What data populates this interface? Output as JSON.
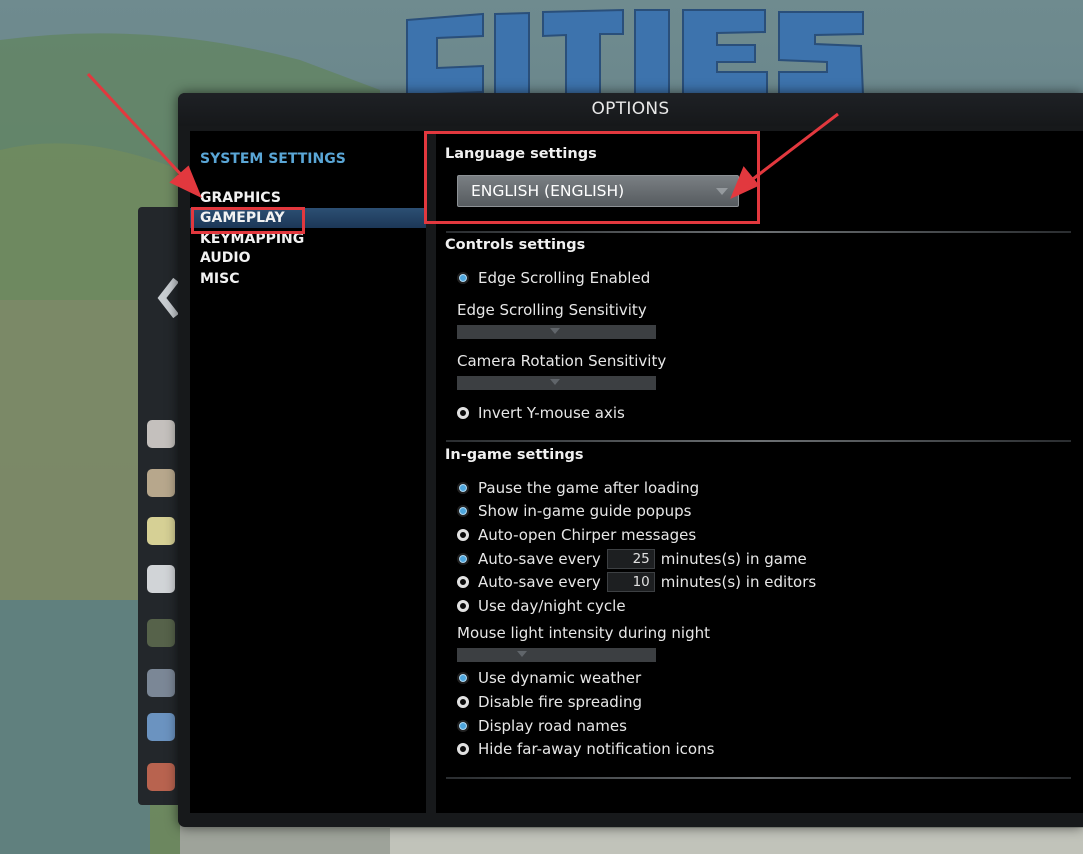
{
  "window": {
    "title": "OPTIONS"
  },
  "logo_text": "CITIES",
  "sidebar": {
    "title": "SYSTEM SETTINGS",
    "items": [
      {
        "label": "GRAPHICS",
        "selected": false
      },
      {
        "label": "GAMEPLAY",
        "selected": true
      },
      {
        "label": "KEYMAPPING",
        "selected": false
      },
      {
        "label": "AUDIO",
        "selected": false
      },
      {
        "label": "MISC",
        "selected": false
      }
    ]
  },
  "language": {
    "title": "Language settings",
    "selected": "ENGLISH (ENGLISH)"
  },
  "controls": {
    "title": "Controls settings",
    "edge_scrolling": {
      "label": "Edge Scrolling Enabled",
      "checked": true
    },
    "edge_sensitivity": {
      "label": "Edge Scrolling Sensitivity"
    },
    "camera_sensitivity": {
      "label": "Camera Rotation Sensitivity"
    },
    "invert_y": {
      "label": "Invert Y-mouse axis",
      "checked": false
    }
  },
  "ingame": {
    "title": "In-game settings",
    "pause_after_loading": {
      "label": "Pause the game after loading",
      "checked": true
    },
    "guide_popups": {
      "label": "Show in-game guide popups",
      "checked": true
    },
    "chirper": {
      "label": "Auto-open Chirper messages",
      "checked": false
    },
    "autosave_game": {
      "label": "Auto-save every",
      "value": "25",
      "suffix": "minutes(s) in game",
      "checked": true
    },
    "autosave_editors": {
      "label": "Auto-save every",
      "value": "10",
      "suffix": "minutes(s) in editors",
      "checked": false
    },
    "day_night": {
      "label": "Use day/night cycle",
      "checked": false
    },
    "mouse_light": {
      "label": "Mouse light intensity during night"
    },
    "dynamic_weather": {
      "label": "Use dynamic weather",
      "checked": true
    },
    "fire_spreading": {
      "label": "Disable fire spreading",
      "checked": false
    },
    "road_names": {
      "label": "Display road names",
      "checked": true
    },
    "far_notifications": {
      "label": "Hide far-away notification icons",
      "checked": false
    }
  },
  "colors": {
    "accent": "#5aa6d6",
    "annotation": "#e2383e",
    "selection": "#2c4f73"
  }
}
